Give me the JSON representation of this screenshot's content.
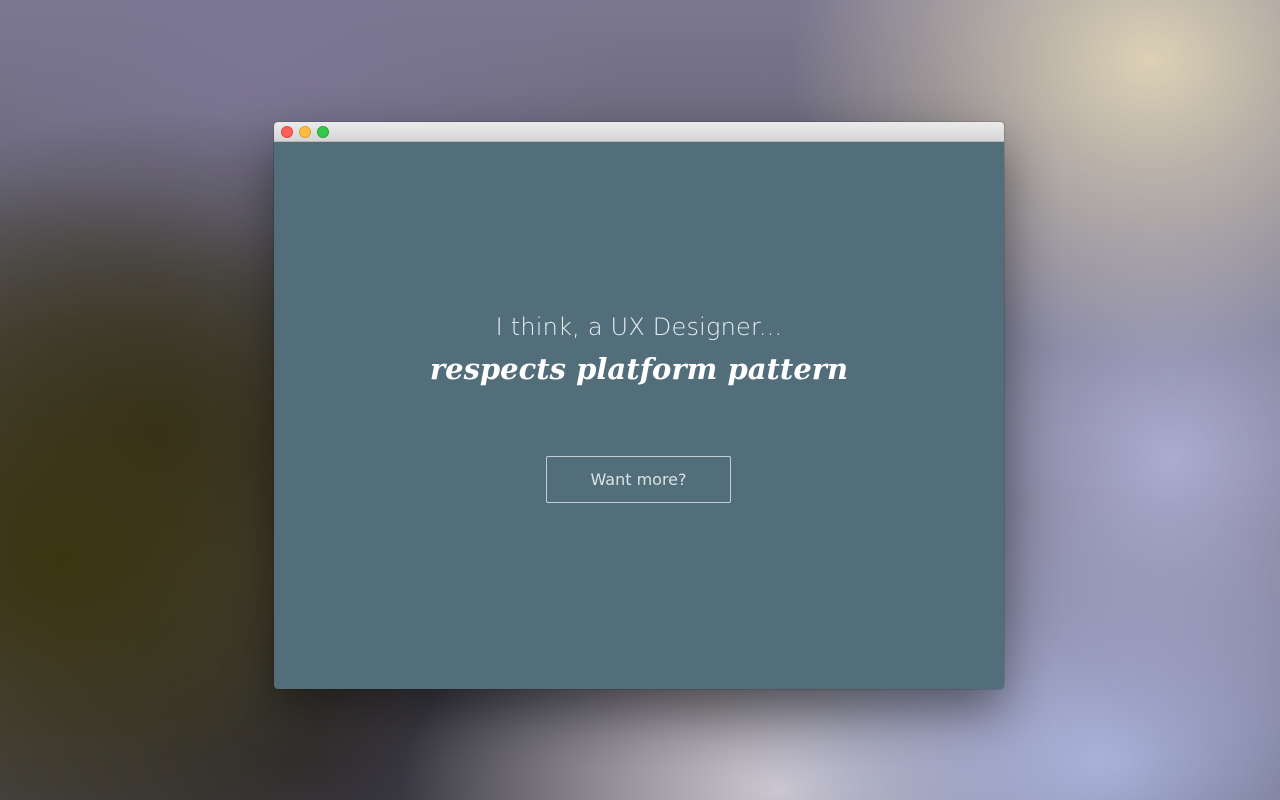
{
  "window": {
    "controls": {
      "close_icon": "close-circle-icon",
      "minimize_icon": "minimize-circle-icon",
      "zoom_icon": "zoom-circle-icon"
    }
  },
  "content": {
    "intro_text": "I think, a UX Designer...",
    "headline": "respects platform pattern",
    "cta_label": "Want more?"
  },
  "colors": {
    "content_background": "#526e7a",
    "close": "#fc605b",
    "minimize": "#fdbc40",
    "zoom": "#34c84a"
  }
}
